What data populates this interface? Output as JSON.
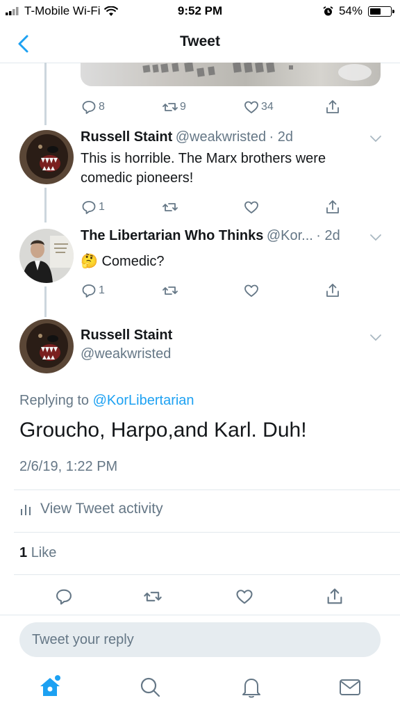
{
  "status_bar": {
    "carrier": "T-Mobile Wi-Fi",
    "time": "9:52 PM",
    "battery": "54%",
    "battery_level": 0.54
  },
  "nav": {
    "title": "Tweet"
  },
  "thread": [
    {
      "stats": {
        "replies": "8",
        "retweets": "9",
        "likes": "34"
      }
    },
    {
      "name": "Russell Staint",
      "handle": "@weakwristed",
      "meta": "· 2d",
      "text": "This is horrible. The Marx brothers were comedic pioneers!",
      "stats": {
        "replies": "1",
        "retweets": "",
        "likes": ""
      }
    },
    {
      "name": "The Libertarian Who Thinks",
      "handle": "@Kor...",
      "meta": "· 2d",
      "emoji": "🤔",
      "text": "Comedic?",
      "stats": {
        "replies": "1",
        "retweets": "",
        "likes": ""
      }
    }
  ],
  "main_tweet": {
    "name": "Russell Staint",
    "handle": "@weakwristed",
    "replying_prefix": "Replying to",
    "replying_to": "@KorLibertarian",
    "text": "Groucho, Harpo,and Karl. Duh!",
    "timestamp": "2/6/19, 1:22 PM",
    "activity_label": "View Tweet activity",
    "like_count": "1",
    "like_label": "Like"
  },
  "reply": {
    "placeholder": "Tweet your reply"
  },
  "colors": {
    "accent": "#1da1f2",
    "muted": "#657786",
    "text": "#14171a",
    "divider": "#e1e8ed"
  },
  "icons": [
    "wifi-icon",
    "alarm-icon",
    "battery-icon",
    "back-chevron-icon",
    "reply-icon",
    "retweet-icon",
    "like-icon",
    "share-icon",
    "chevron-down-icon",
    "activity-bars-icon",
    "home-icon",
    "search-icon",
    "notifications-icon",
    "messages-icon"
  ]
}
